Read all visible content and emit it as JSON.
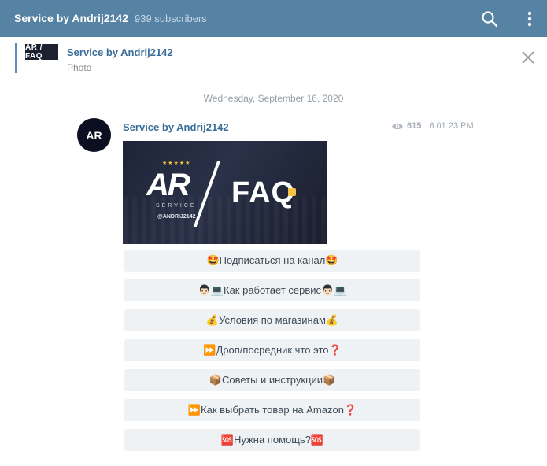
{
  "header": {
    "title": "Service by Andrij2142",
    "subscribers": "939 subscribers",
    "search_icon": "search-icon",
    "menu_icon": "vertical-dots-icon"
  },
  "pinned": {
    "thumb_text": "AR / FAQ",
    "title": "Service by Andrij2142",
    "caption": "Photo",
    "close_icon": "close-icon"
  },
  "date_separator": "Wednesday, September 16, 2020",
  "message": {
    "avatar_text": "AR",
    "author": "Service by Andrij2142",
    "views": "615",
    "time": "6:01:23 PM",
    "photo": {
      "logo": "AR",
      "service": "SERVICE",
      "stars": "★★★★★",
      "handle": "@ANDRIJ2142",
      "faq": "FAQ"
    },
    "buttons": [
      "🤩Подписаться на канал🤩",
      "👨🏻💻Как работает сервис👨🏻💻",
      "💰Условия по магазинам💰",
      "⏩Дроп/посредник что это❓",
      "📦Советы и инструкции📦",
      "⏩Как выбрать товар на Amazon❓",
      "🆘Нужна помощь?🆘"
    ]
  },
  "colors": {
    "header_bg": "#5682a3",
    "link": "#3a6d99",
    "button_bg": "#eef2f5"
  }
}
